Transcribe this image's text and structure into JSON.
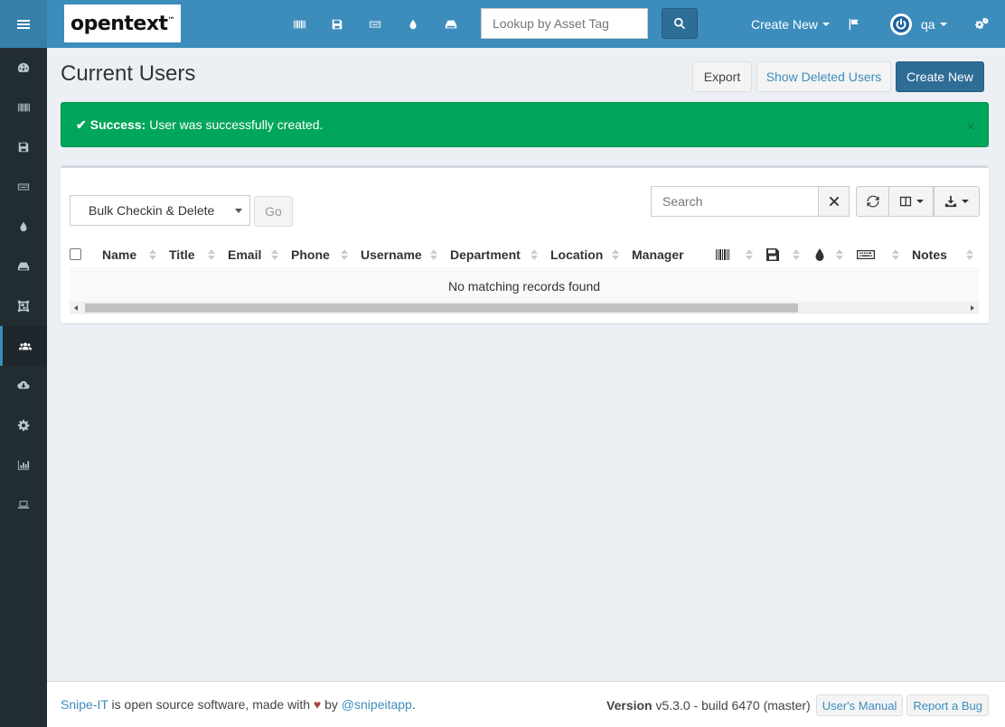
{
  "header": {
    "logo_text": "opentext",
    "logo_tm": "™",
    "search_placeholder": "Lookup by Asset Tag",
    "create_new_label": "Create New",
    "user_name": "qa",
    "accent_color": "#3c8dbc"
  },
  "page": {
    "title": "Current Users",
    "export_label": "Export",
    "show_deleted_label": "Show Deleted Users",
    "create_new_label": "Create New"
  },
  "alert": {
    "strong": "Success:",
    "message": "User was successfully created.",
    "close": "×",
    "color": "#00a65a"
  },
  "table": {
    "bulk_action": "Bulk Checkin & Delete",
    "go_label": "Go",
    "search_placeholder": "Search",
    "columns": [
      "Name",
      "Title",
      "Email",
      "Phone",
      "Username",
      "Department",
      "Location",
      "Manager",
      "Notes"
    ],
    "icon_columns": [
      "barcode-icon",
      "floppy-icon",
      "drop-icon",
      "keyboard-icon"
    ],
    "empty_message": "No matching records found"
  },
  "footer": {
    "brand": "Snipe-IT",
    "text_mid": " is open source software, made with ",
    "text_by": " by ",
    "handle": "@snipeitapp",
    "period": ".",
    "version_label": "Version",
    "version_value": " v5.3.0 - build 6470 (master)",
    "manual_label": "User's Manual",
    "bug_label": "Report a Bug"
  }
}
